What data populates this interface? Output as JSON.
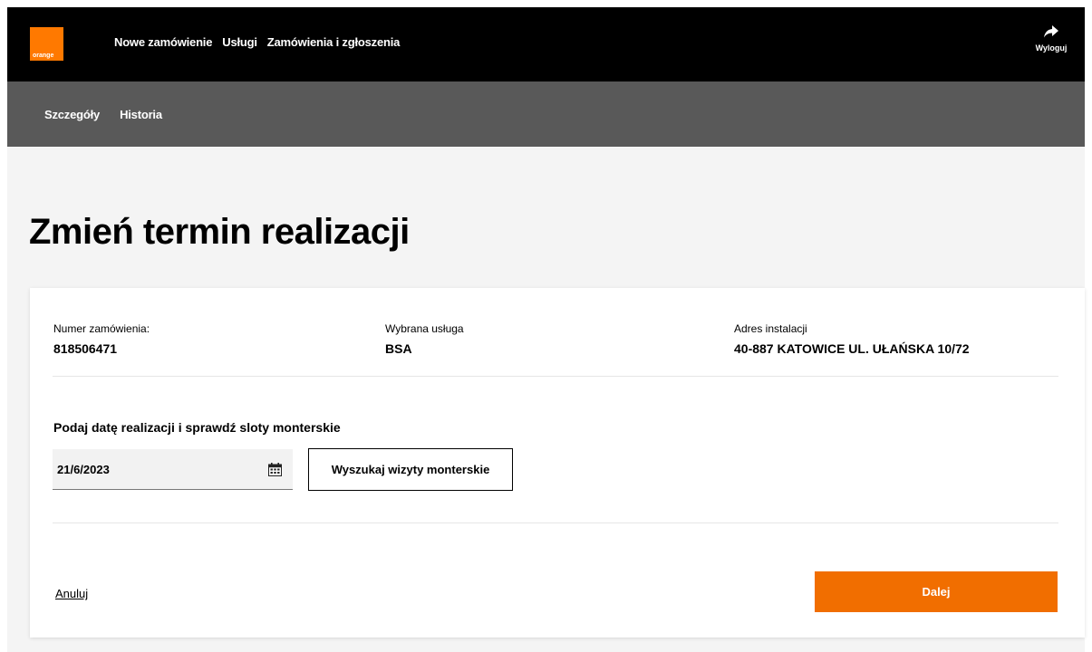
{
  "brand": {
    "logo_text": "orange",
    "accent": "#ff7900",
    "button_color": "#f16e00"
  },
  "topnav": {
    "items": [
      {
        "label": "Nowe zamówienie"
      },
      {
        "label": "Usługi"
      },
      {
        "label": "Zamówienia i zgłoszenia"
      }
    ],
    "logout_label": "Wyloguj",
    "logout_icon": "share-arrow-icon"
  },
  "subnav": {
    "items": [
      {
        "label": "Szczegóły"
      },
      {
        "label": "Historia"
      }
    ]
  },
  "page": {
    "title": "Zmień termin realizacji"
  },
  "order": {
    "number_label": "Numer zamówienia:",
    "number_value": "818506471",
    "service_label": "Wybrana usługa",
    "service_value": "BSA",
    "address_label": "Adres instalacji",
    "address_value": "40-887 KATOWICE UL. UŁAŃSKA 10/72"
  },
  "form": {
    "section_label": "Podaj datę realizacji i sprawdź sloty monterskie",
    "date_value": "21/6/2023",
    "date_icon": "calendar-icon",
    "search_button": "Wyszukaj wizyty monterskie"
  },
  "actions": {
    "cancel_label": "Anuluj",
    "next_label": "Dalej"
  }
}
